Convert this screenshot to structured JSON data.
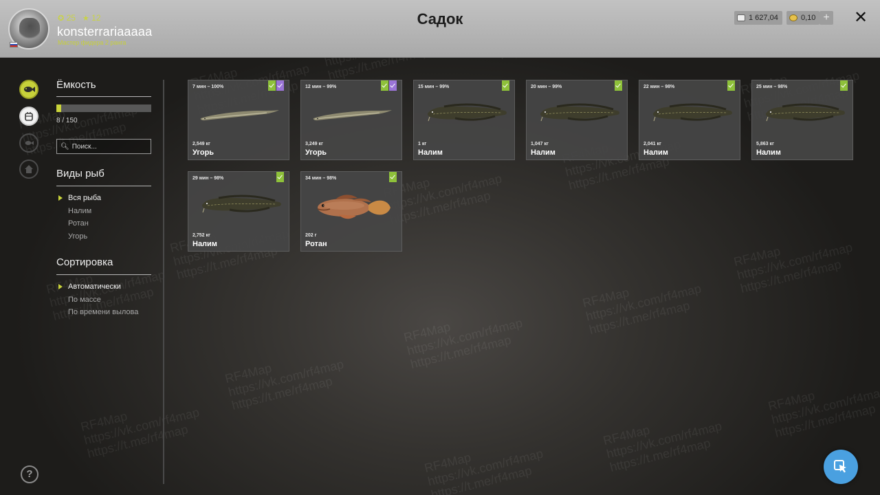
{
  "header": {
    "title": "Садок",
    "username": "konsterrariaaaaa",
    "rank": "Мастер фидера 2 ранга",
    "level": "25",
    "stars": "12",
    "silver": "1 627,04",
    "gold": "0,10",
    "plus_label": "+",
    "close_label": "✕"
  },
  "sidebar": {
    "capacity_title": "Ёмкость",
    "capacity_text": "8 / 150",
    "capacity_fraction": 0.053,
    "search_placeholder": "Поиск...",
    "species_title": "Виды рыб",
    "species": [
      "Вся рыба",
      "Налим",
      "Ротан",
      "Угорь"
    ],
    "sort_title": "Сортировка",
    "sort_options": [
      "Автоматически",
      "По массе",
      "По времени вылова"
    ],
    "help_label": "?"
  },
  "fish": [
    {
      "time": "7 мин – 100%",
      "weight": "2,549 кг",
      "name": "Угорь",
      "kind": "eel",
      "badges": [
        "green",
        "purple"
      ]
    },
    {
      "time": "12 мин – 99%",
      "weight": "3,249 кг",
      "name": "Угорь",
      "kind": "eel",
      "badges": [
        "green",
        "purple"
      ]
    },
    {
      "time": "15 мин – 99%",
      "weight": "1 кг",
      "name": "Налим",
      "kind": "burbot",
      "badges": [
        "green"
      ]
    },
    {
      "time": "20 мин – 99%",
      "weight": "1,047 кг",
      "name": "Налим",
      "kind": "burbot",
      "badges": [
        "green"
      ]
    },
    {
      "time": "22 мин – 98%",
      "weight": "2,041 кг",
      "name": "Налим",
      "kind": "burbot",
      "badges": [
        "green"
      ]
    },
    {
      "time": "25 мин – 98%",
      "weight": "5,863 кг",
      "name": "Налим",
      "kind": "burbot",
      "badges": [
        "green"
      ]
    },
    {
      "time": "29 мин – 98%",
      "weight": "2,752 кг",
      "name": "Налим",
      "kind": "burbot",
      "badges": [
        "green"
      ]
    },
    {
      "time": "34 мин – 98%",
      "weight": "202 г",
      "name": "Ротан",
      "kind": "rotan",
      "badges": [
        "green"
      ]
    }
  ],
  "watermark": {
    "site": "RF4Map",
    "vk": "https://vk.com/rf4map",
    "tg": "https://t.me/rf4map"
  },
  "colors": {
    "accent": "#c9d33a",
    "badge_green": "#8ec13a",
    "badge_purple": "#9a74d6",
    "cursor_button": "#4aa0e0"
  }
}
